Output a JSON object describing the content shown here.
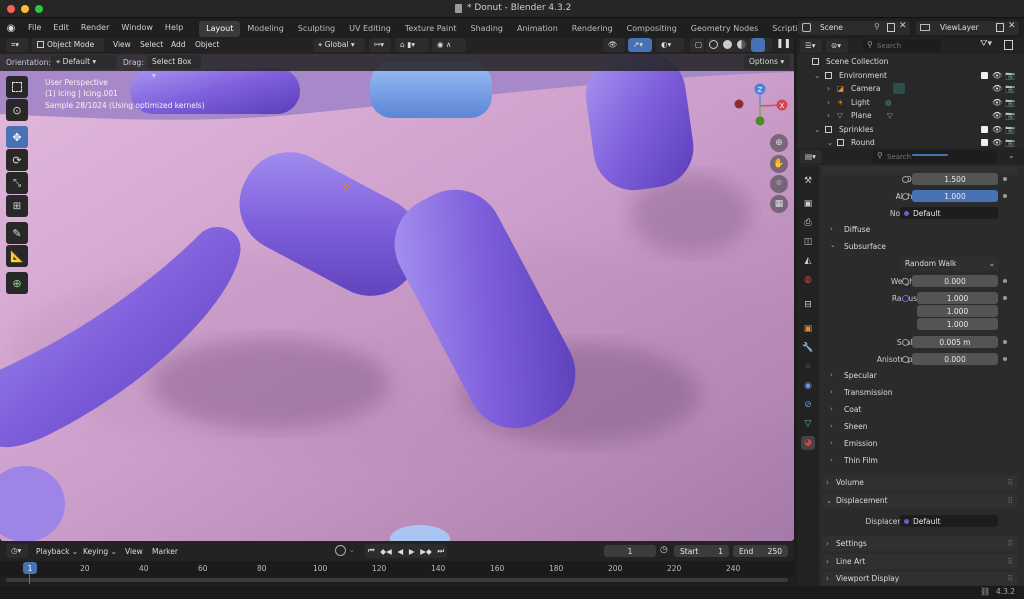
{
  "window": {
    "title": "* Donut - Blender 4.3.2"
  },
  "menu": [
    "File",
    "Edit",
    "Render",
    "Window",
    "Help"
  ],
  "workspaces": [
    "Layout",
    "Modeling",
    "Sculpting",
    "UV Editing",
    "Texture Paint",
    "Shading",
    "Animation",
    "Rendering",
    "Compositing",
    "Geometry Nodes",
    "Scripting"
  ],
  "active_workspace": "Layout",
  "scene": {
    "scene_label": "Scene",
    "viewlayer_label": "ViewLayer"
  },
  "viewport_header": {
    "mode": "Object Mode",
    "menus": [
      "View",
      "Select",
      "Add",
      "Object"
    ],
    "transform": "Global"
  },
  "tool_settings": {
    "orientation_label": "Orientation:",
    "orientation_value": "Default",
    "drag_label": "Drag:",
    "drag_value": "Select Box",
    "options": "Options"
  },
  "overlay_text": {
    "line1": "User Perspective",
    "line2": "(1) Icing | Icing.001",
    "line3": "Sample 28/1024 (Using optimized kernels)"
  },
  "outliner": {
    "search_placeholder": "Search",
    "items": [
      {
        "label": "Scene Collection",
        "indent": 0
      },
      {
        "label": "Environment",
        "indent": 1
      },
      {
        "label": "Camera",
        "indent": 2
      },
      {
        "label": "Light",
        "indent": 2
      },
      {
        "label": "Plane",
        "indent": 2
      },
      {
        "label": "Sprinkles",
        "indent": 1
      },
      {
        "label": "Round",
        "indent": 2
      }
    ]
  },
  "properties": {
    "search_placeholder": "Search",
    "ior": {
      "label": "IOR",
      "value": "1.500"
    },
    "alpha": {
      "label": "Alpha",
      "value": "1.000"
    },
    "normal": {
      "label": "Normal",
      "value": "Default"
    },
    "diffuse": "Diffuse",
    "subsurface": "Subsurface",
    "subsurface_method": "Random Walk",
    "weight": {
      "label": "Weight",
      "value": "0.000"
    },
    "radius": {
      "label": "Radius",
      "values": [
        "1.000",
        "1.000",
        "1.000"
      ]
    },
    "scale": {
      "label": "Scale",
      "value": "0.005 m"
    },
    "anisotropy": {
      "label": "Anisotropy",
      "value": "0.000"
    },
    "specular": "Specular",
    "transmission": "Transmission",
    "coat": "Coat",
    "sheen": "Sheen",
    "emission": "Emission",
    "thin_film": "Thin Film",
    "volume": "Volume",
    "displacement": "Displacement",
    "displacement_field": {
      "label": "Displacement",
      "value": "Default"
    },
    "settings": "Settings",
    "line_art": "Line Art",
    "viewport_display": "Viewport Display"
  },
  "timeline": {
    "menus": [
      "Playback",
      "Keying",
      "View",
      "Marker"
    ],
    "current_frame": "1",
    "start_label": "Start",
    "start_value": "1",
    "end_label": "End",
    "end_value": "250",
    "ticks": [
      "1",
      "20",
      "40",
      "60",
      "80",
      "100",
      "120",
      "140",
      "160",
      "180",
      "200",
      "220",
      "240"
    ]
  },
  "status": {
    "version": "4.3.2"
  },
  "colors": {
    "accent": "#4772b3",
    "viewport_bg": "#cfa2cb",
    "sprinkle": "#8b6fe0"
  }
}
